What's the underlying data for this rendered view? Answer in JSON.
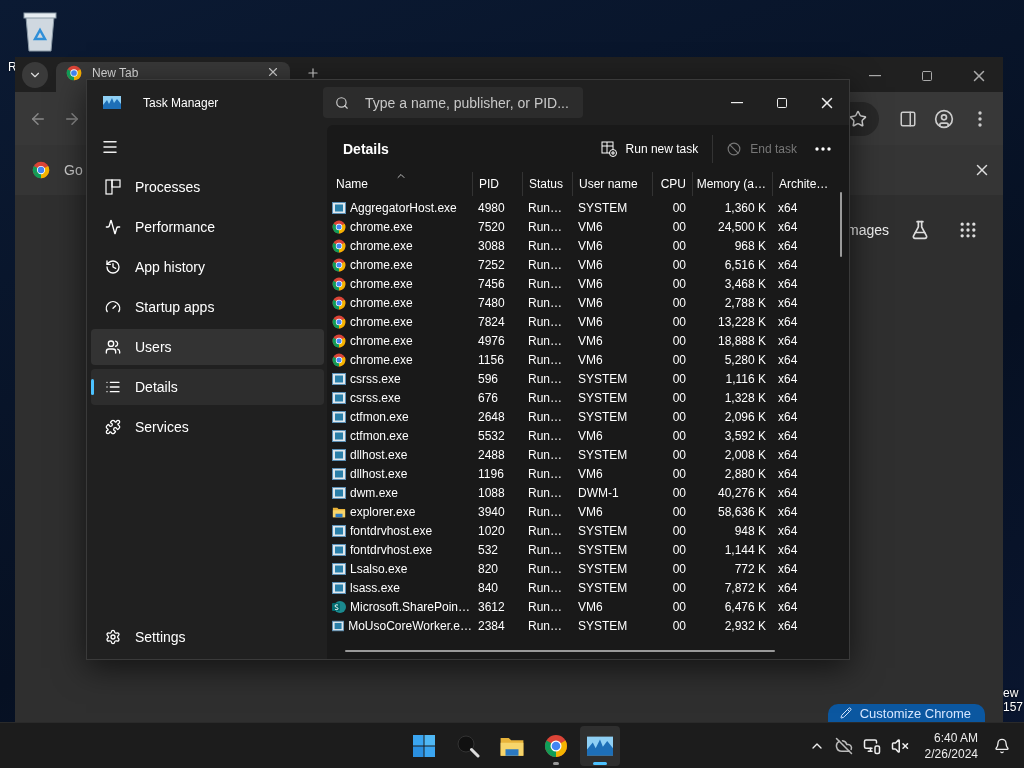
{
  "desktop": {
    "left_label": "R",
    "right_labels": [
      "ew",
      "157"
    ]
  },
  "browser": {
    "tab": {
      "title": "New Tab"
    },
    "infobar": {
      "text": "Go"
    },
    "content": {
      "link": "mages",
      "customize_button": "Customize Chrome"
    }
  },
  "task_manager": {
    "title": "Task Manager",
    "search": {
      "placeholder": "Type a name, publisher, or PID..."
    },
    "nav": [
      {
        "label": "Processes",
        "selected": false,
        "hovered": false
      },
      {
        "label": "Performance",
        "selected": false,
        "hovered": false
      },
      {
        "label": "App history",
        "selected": false,
        "hovered": false
      },
      {
        "label": "Startup apps",
        "selected": false,
        "hovered": false
      },
      {
        "label": "Users",
        "selected": false,
        "hovered": true
      },
      {
        "label": "Details",
        "selected": true,
        "hovered": false
      },
      {
        "label": "Services",
        "selected": false,
        "hovered": false
      }
    ],
    "settings": {
      "label": "Settings"
    },
    "page_title": "Details",
    "commands": [
      {
        "label": "Run new task",
        "disabled": false
      },
      {
        "label": "End task",
        "disabled": true
      }
    ],
    "table": {
      "columns": [
        {
          "label": "Name",
          "sorted": true
        },
        {
          "label": "PID",
          "sorted": false
        },
        {
          "label": "Status",
          "sorted": false
        },
        {
          "label": "User name",
          "sorted": false
        },
        {
          "label": "CPU",
          "sorted": false
        },
        {
          "label": "Memory (a…",
          "sorted": false
        },
        {
          "label": "Archite…",
          "sorted": false
        }
      ],
      "rows": [
        {
          "kind": "app",
          "cells": [
            "AggregatorHost.exe",
            "4980",
            "Run…",
            "SYSTEM",
            "00",
            "1,360 K",
            "x64"
          ]
        },
        {
          "kind": "chrome",
          "cells": [
            "chrome.exe",
            "7520",
            "Run…",
            "VM6",
            "00",
            "24,500 K",
            "x64"
          ]
        },
        {
          "kind": "chrome",
          "cells": [
            "chrome.exe",
            "3088",
            "Run…",
            "VM6",
            "00",
            "968 K",
            "x64"
          ]
        },
        {
          "kind": "chrome",
          "cells": [
            "chrome.exe",
            "7252",
            "Run…",
            "VM6",
            "00",
            "6,516 K",
            "x64"
          ]
        },
        {
          "kind": "chrome",
          "cells": [
            "chrome.exe",
            "7456",
            "Run…",
            "VM6",
            "00",
            "3,468 K",
            "x64"
          ]
        },
        {
          "kind": "chrome",
          "cells": [
            "chrome.exe",
            "7480",
            "Run…",
            "VM6",
            "00",
            "2,788 K",
            "x64"
          ]
        },
        {
          "kind": "chrome",
          "cells": [
            "chrome.exe",
            "7824",
            "Run…",
            "VM6",
            "00",
            "13,228 K",
            "x64"
          ]
        },
        {
          "kind": "chrome",
          "cells": [
            "chrome.exe",
            "4976",
            "Run…",
            "VM6",
            "00",
            "18,888 K",
            "x64"
          ]
        },
        {
          "kind": "chrome",
          "cells": [
            "chrome.exe",
            "1156",
            "Run…",
            "VM6",
            "00",
            "5,280 K",
            "x64"
          ]
        },
        {
          "kind": "app",
          "cells": [
            "csrss.exe",
            "596",
            "Run…",
            "SYSTEM",
            "00",
            "1,116 K",
            "x64"
          ]
        },
        {
          "kind": "app",
          "cells": [
            "csrss.exe",
            "676",
            "Run…",
            "SYSTEM",
            "00",
            "1,328 K",
            "x64"
          ]
        },
        {
          "kind": "app",
          "cells": [
            "ctfmon.exe",
            "2648",
            "Run…",
            "SYSTEM",
            "00",
            "2,096 K",
            "x64"
          ]
        },
        {
          "kind": "app",
          "cells": [
            "ctfmon.exe",
            "5532",
            "Run…",
            "VM6",
            "00",
            "3,592 K",
            "x64"
          ]
        },
        {
          "kind": "app",
          "cells": [
            "dllhost.exe",
            "2488",
            "Run…",
            "SYSTEM",
            "00",
            "2,008 K",
            "x64"
          ]
        },
        {
          "kind": "app",
          "cells": [
            "dllhost.exe",
            "1196",
            "Run…",
            "VM6",
            "00",
            "2,880 K",
            "x64"
          ]
        },
        {
          "kind": "app",
          "cells": [
            "dwm.exe",
            "1088",
            "Run…",
            "DWM-1",
            "00",
            "40,276 K",
            "x64"
          ]
        },
        {
          "kind": "folder",
          "cells": [
            "explorer.exe",
            "3940",
            "Run…",
            "VM6",
            "00",
            "58,636 K",
            "x64"
          ]
        },
        {
          "kind": "app",
          "cells": [
            "fontdrvhost.exe",
            "1020",
            "Run…",
            "SYSTEM",
            "00",
            "948 K",
            "x64"
          ]
        },
        {
          "kind": "app",
          "cells": [
            "fontdrvhost.exe",
            "532",
            "Run…",
            "SYSTEM",
            "00",
            "1,144 K",
            "x64"
          ]
        },
        {
          "kind": "app",
          "cells": [
            "Lsalso.exe",
            "820",
            "Run…",
            "SYSTEM",
            "00",
            "772 K",
            "x64"
          ]
        },
        {
          "kind": "app",
          "cells": [
            "lsass.exe",
            "840",
            "Run…",
            "SYSTEM",
            "00",
            "7,872 K",
            "x64"
          ]
        },
        {
          "kind": "sharepoint",
          "cells": [
            "Microsoft.SharePoin…",
            "3612",
            "Run…",
            "VM6",
            "00",
            "6,476 K",
            "x64"
          ]
        },
        {
          "kind": "app",
          "cells": [
            "MoUsoCoreWorker.e…",
            "2384",
            "Run…",
            "SYSTEM",
            "00",
            "2,932 K",
            "x64"
          ]
        }
      ]
    }
  },
  "taskbar": {
    "apps": [
      {
        "kind": "start",
        "running": false,
        "active": false
      },
      {
        "kind": "search",
        "running": false,
        "active": false
      },
      {
        "kind": "folder",
        "running": false,
        "active": false
      },
      {
        "kind": "chrome",
        "running": true,
        "active": false
      },
      {
        "kind": "taskmanager",
        "running": true,
        "active": true
      }
    ],
    "time": "6:40 AM",
    "date": "2/26/2024"
  }
}
